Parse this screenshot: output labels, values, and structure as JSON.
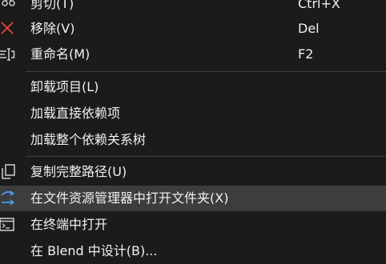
{
  "menu": {
    "cut": {
      "label": "剪切(T)",
      "shortcut": "Ctrl+X",
      "icon": "scissors-icon"
    },
    "remove": {
      "label": "移除(V)",
      "shortcut": "Del",
      "icon": "remove-x-icon"
    },
    "rename": {
      "label": "重命名(M)",
      "shortcut": "F2",
      "icon": "rename-icon"
    },
    "unload": {
      "label": "卸载项目(L)"
    },
    "load_direct": {
      "label": "加载直接依赖项"
    },
    "load_tree": {
      "label": "加载整个依赖关系树"
    },
    "copy_path": {
      "label": "复制完整路径(U)",
      "icon": "copy-icon"
    },
    "open_in_explorer": {
      "label": "在文件资源管理器中打开文件夹(X)",
      "icon": "open-folder-arrow-icon",
      "highlighted": true
    },
    "open_in_terminal": {
      "label": "在终端中打开",
      "icon": "terminal-icon"
    },
    "design_in_blend": {
      "label": "在 Blend 中设计(B)..."
    }
  },
  "colors": {
    "background": "#1b1b1c",
    "highlight": "#3d3d3d",
    "separator": "#3f3f46",
    "text": "#f1f1f1",
    "remove_red": "#e8473e",
    "accent_blue": "#4da3ff"
  }
}
